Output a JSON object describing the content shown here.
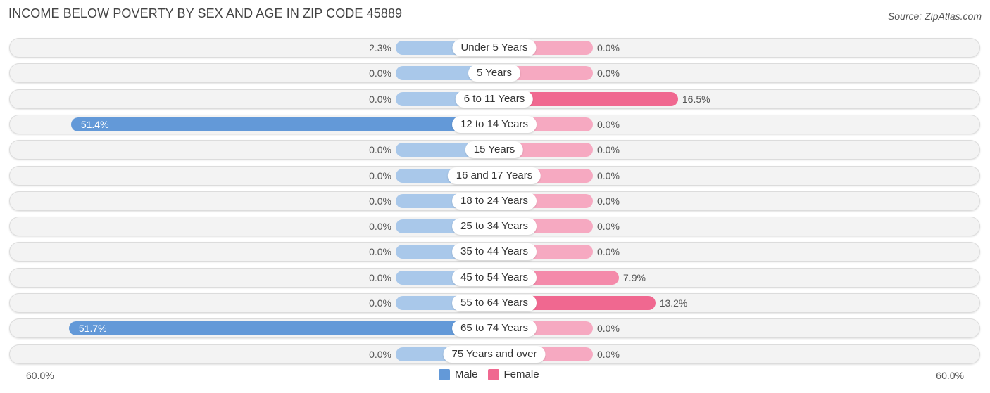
{
  "chart_data": {
    "type": "bar",
    "orientation": "horizontal-diverging",
    "title": "INCOME BELOW POVERTY BY SEX AND AGE IN ZIP CODE 45889",
    "source": "Source: ZipAtlas.com",
    "categories": [
      "Under 5 Years",
      "5 Years",
      "6 to 11 Years",
      "12 to 14 Years",
      "15 Years",
      "16 and 17 Years",
      "18 to 24 Years",
      "25 to 34 Years",
      "35 to 44 Years",
      "45 to 54 Years",
      "55 to 64 Years",
      "65 to 74 Years",
      "75 Years and over"
    ],
    "series": [
      {
        "name": "Male",
        "color": "#6399d8",
        "light_color": "#a9c8ea",
        "values": [
          2.3,
          0.0,
          0.0,
          51.4,
          0.0,
          0.0,
          0.0,
          0.0,
          0.0,
          0.0,
          0.0,
          51.7,
          0.0
        ],
        "labels": [
          "2.3%",
          "0.0%",
          "0.0%",
          "51.4%",
          "0.0%",
          "0.0%",
          "0.0%",
          "0.0%",
          "0.0%",
          "0.0%",
          "0.0%",
          "51.7%",
          "0.0%"
        ]
      },
      {
        "name": "Female",
        "color": "#f06890",
        "light_color": "#f6a9c1",
        "values": [
          0.0,
          0.0,
          16.5,
          0.0,
          0.0,
          0.0,
          0.0,
          0.0,
          0.0,
          7.9,
          13.2,
          0.0,
          0.0
        ],
        "labels": [
          "0.0%",
          "0.0%",
          "16.5%",
          "0.0%",
          "0.0%",
          "0.0%",
          "0.0%",
          "0.0%",
          "0.0%",
          "7.9%",
          "13.2%",
          "0.0%",
          "0.0%"
        ]
      }
    ],
    "xlim": [
      -60,
      60
    ],
    "axis_labels": {
      "left": "60.0%",
      "right": "60.0%"
    },
    "legend": {
      "position": "bottom-center",
      "entries": [
        "Male",
        "Female"
      ]
    },
    "xlabel": "",
    "ylabel": ""
  }
}
